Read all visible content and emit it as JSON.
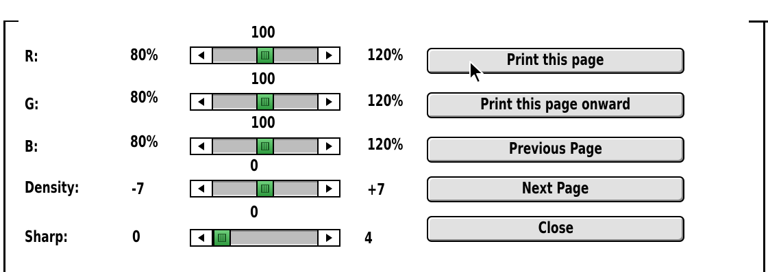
{
  "sliders": [
    {
      "label": "R:",
      "min_label": "80%",
      "max_label": "120%",
      "value_label": "100",
      "position": 0.5
    },
    {
      "label": "G:",
      "min_label": "80%",
      "max_label": "120%",
      "value_label": "100",
      "position": 0.5
    },
    {
      "label": "B:",
      "min_label": "80%",
      "max_label": "120%",
      "value_label": "100",
      "position": 0.5
    },
    {
      "label": "Density:",
      "min_label": "-7",
      "max_label": "+7",
      "value_label": "0",
      "position": 0.5
    },
    {
      "label": "Sharp:",
      "min_label": "0",
      "max_label": "4",
      "value_label": "0",
      "position": 0.0
    }
  ],
  "buttons": {
    "print_page": "Print this page",
    "print_onward": "Print this page onward",
    "previous_page": "Previous Page",
    "next_page": "Next Page",
    "close": "Close"
  },
  "colors": {
    "thumb": "#3fae4f",
    "button_face": "#e1e1e1",
    "track": "#bdbdbd"
  },
  "icons": {
    "cursor": "arrow-cursor-icon",
    "slider_left": "left-arrow-icon",
    "slider_right": "right-arrow-icon"
  }
}
